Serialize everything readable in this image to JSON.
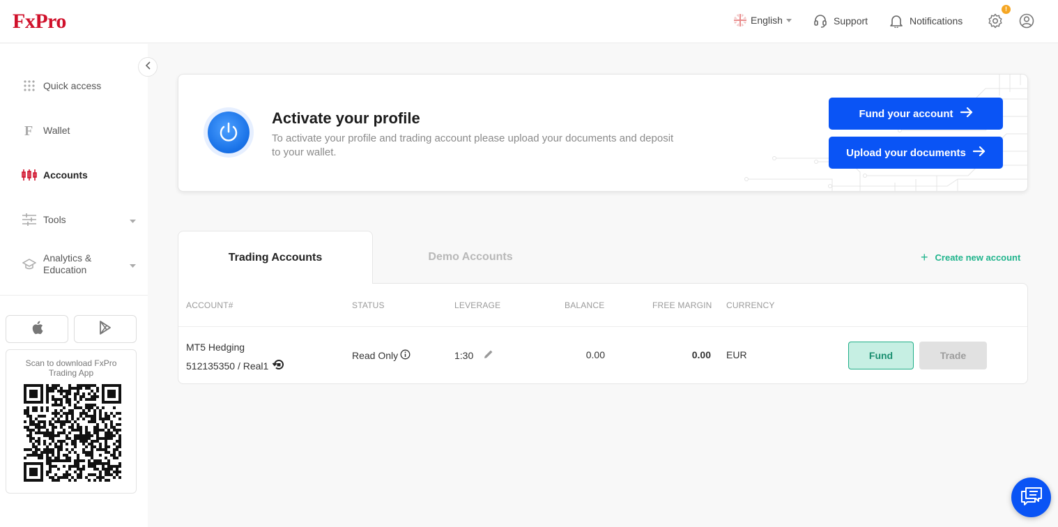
{
  "brand": {
    "logo_text": "FxPro",
    "color": "#d0112b"
  },
  "header": {
    "language": "English",
    "support": "Support",
    "notifications": "Notifications",
    "settings_badge": "!"
  },
  "sidebar": {
    "items": [
      {
        "label": "Quick access",
        "icon": "grid-icon"
      },
      {
        "label": "Wallet",
        "icon": "wallet-f-icon"
      },
      {
        "label": "Accounts",
        "icon": "candlestick-icon",
        "active": true
      },
      {
        "label": "Tools",
        "icon": "sliders-icon",
        "expandable": true
      },
      {
        "label_line1": "Analytics &",
        "label_line2": "Education",
        "icon": "graduation-cap-icon",
        "expandable": true
      }
    ],
    "qr_caption": "Scan to download FxPro Trading App"
  },
  "activate": {
    "title": "Activate your profile",
    "text": "To activate your profile and trading account please upload your documents and deposit to your wallet.",
    "fund_button": "Fund your account",
    "upload_button": "Upload your documents"
  },
  "tabs": {
    "trading": "Trading Accounts",
    "demo": "Demo Accounts"
  },
  "create_account": "Create new account",
  "table": {
    "headers": {
      "account": "ACCOUNT#",
      "status": "STATUS",
      "leverage": "LEVERAGE",
      "balance": "BALANCE",
      "free_margin": "FREE MARGIN",
      "currency": "CURRENCY"
    },
    "rows": [
      {
        "name": "MT5 Hedging",
        "number": "512135350 / Real1",
        "status": "Read Only",
        "leverage": "1:30",
        "balance": "0.00",
        "free_margin": "0.00",
        "currency": "EUR",
        "fund_label": "Fund",
        "trade_label": "Trade"
      }
    ]
  },
  "colors": {
    "primary_blue": "#0a54f5",
    "green": "#20b48c",
    "fund_bg": "#c6efe3"
  }
}
